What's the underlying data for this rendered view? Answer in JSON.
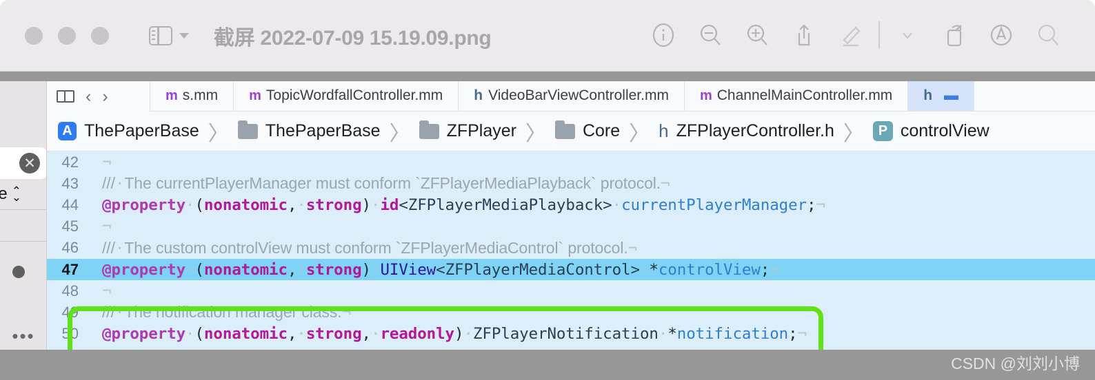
{
  "window": {
    "title": "截屏 2022-07-09 15.19.09.png",
    "traffic_lights": [
      "close",
      "minimize",
      "zoom"
    ],
    "sidebar_toggle_label": "sidebar-toggle",
    "toolbar_buttons": [
      {
        "name": "info-icon",
        "label": "Info"
      },
      {
        "name": "zoom-out-icon",
        "label": "Zoom Out"
      },
      {
        "name": "zoom-in-icon",
        "label": "Zoom In"
      },
      {
        "name": "share-icon",
        "label": "Share"
      },
      {
        "name": "markup-pen-icon",
        "label": "Show Markup Toolbar"
      },
      {
        "name": "chevron-down-icon",
        "label": "More"
      },
      {
        "name": "rotate-icon",
        "label": "Rotate"
      },
      {
        "name": "annotate-icon",
        "label": "Annotate"
      },
      {
        "name": "search-icon",
        "label": "Search"
      }
    ]
  },
  "xcode": {
    "nav": {
      "back": "‹",
      "forward": "›",
      "grid": "editor-layout"
    },
    "tabs": [
      {
        "label": "s.mm",
        "icon": "m",
        "selected": false
      },
      {
        "label": "TopicWordfallController.mm",
        "icon": "m",
        "selected": false
      },
      {
        "label": "VideoBarViewController.mm",
        "icon": "h",
        "selected": false
      },
      {
        "label": "ChannelMainController.mm",
        "icon": "m",
        "selected": false
      },
      {
        "label": "",
        "icon": "h",
        "selected": true
      }
    ],
    "breadcrumb": [
      {
        "label": "ThePaperBase",
        "icon": "app"
      },
      {
        "label": "ThePaperBase",
        "icon": "folder"
      },
      {
        "label": "ZFPlayer",
        "icon": "folder"
      },
      {
        "label": "Core",
        "icon": "folder"
      },
      {
        "label": "ZFPlayerController.h",
        "icon": "header"
      },
      {
        "label": "controlView",
        "icon": "property"
      }
    ],
    "separator": "〉",
    "lines": [
      {
        "num": "42",
        "type": "blank"
      },
      {
        "num": "43",
        "type": "comment",
        "slashes": "///",
        "text": "The currentPlayerManager must conform `ZFPlayerMediaPlayback` protocol."
      },
      {
        "num": "44",
        "type": "code",
        "text": "@property (nonatomic, strong) id<ZFPlayerMediaPlayback> currentPlayerManager;"
      },
      {
        "num": "45",
        "type": "blank"
      },
      {
        "num": "46",
        "type": "comment",
        "slashes": "///",
        "text": "The custom controlView must conform `ZFPlayerMediaControl` protocol."
      },
      {
        "num": "47",
        "type": "code",
        "highlighted": true,
        "text": "@property (nonatomic, strong) UIView<ZFPlayerMediaControl> *controlView;"
      },
      {
        "num": "48",
        "type": "blank"
      },
      {
        "num": "49",
        "type": "comment",
        "slashes": "///",
        "text": "The notification manager class."
      },
      {
        "num": "50",
        "type": "code",
        "text": "@property (nonatomic, strong, readonly) ZFPlayerNotification *notification;"
      }
    ],
    "invisible_newline": "¬",
    "invisible_space": "·"
  },
  "left_pane": {
    "clear_button": "✕",
    "scope_label": "ase",
    "ellipsis": "•••"
  },
  "annotation": {
    "shape": "rounded-rectangle",
    "color": "#5fe316",
    "covers_lines": [
      "45",
      "46",
      "47",
      "48"
    ]
  },
  "watermark": {
    "text": "CSDN @刘刘小博"
  },
  "colors": {
    "titlebar_bg": "#eceaec",
    "editor_bg": "#dbeefa",
    "highlight_line": "#7fd3f4",
    "keyword": "#ad3ab0",
    "variable": "#2f7fd0",
    "comment": "#9aa7b1",
    "annotation_green": "#5fe316",
    "backdrop": "#979797"
  }
}
